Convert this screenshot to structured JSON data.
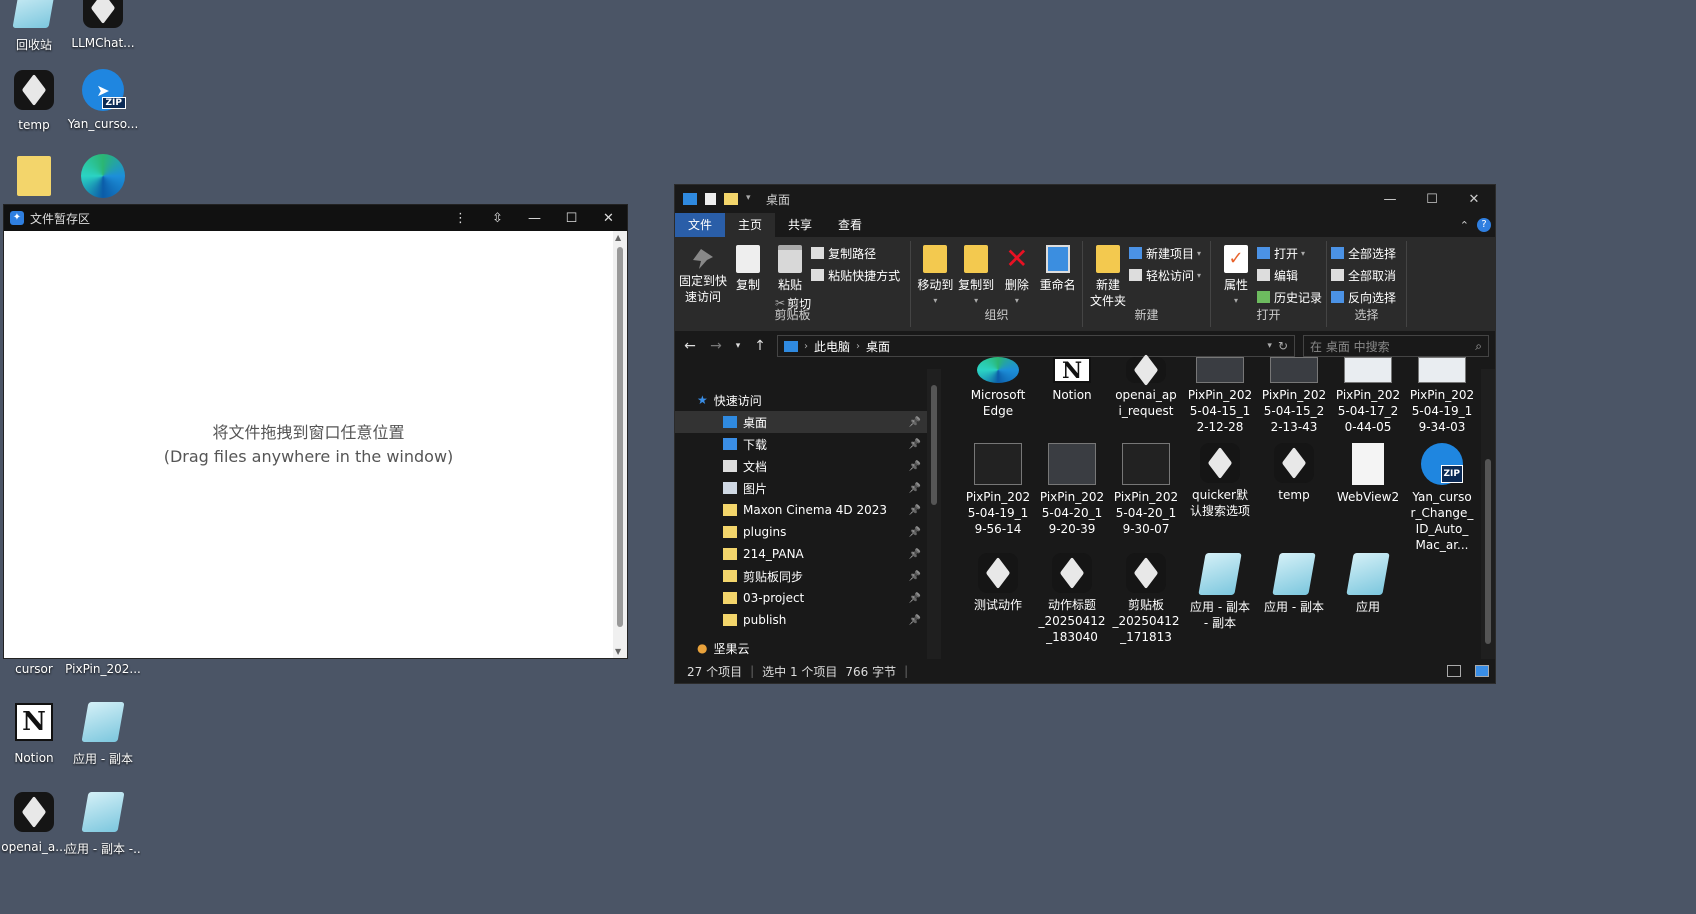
{
  "desktop": {
    "icons": [
      {
        "label": "回收站",
        "kind": "note"
      },
      {
        "label": "LLMChat...",
        "kind": "dark"
      },
      {
        "label": "temp",
        "kind": "dark"
      },
      {
        "label": "Yan_curso...",
        "kind": "zip"
      },
      {
        "label": "",
        "kind": "folder"
      },
      {
        "label": "",
        "kind": "edge"
      },
      {
        "label": "cursor",
        "kind": "dark"
      },
      {
        "label": "PixPin_202...",
        "kind": "shot"
      },
      {
        "label": "Notion",
        "kind": "notion"
      },
      {
        "label": "应用 - 副本",
        "kind": "note"
      },
      {
        "label": "openai_a...",
        "kind": "dark"
      },
      {
        "label": "应用 - 副本 -...",
        "kind": "note"
      }
    ]
  },
  "drop_window": {
    "title": "文件暂存区",
    "line1": "将文件拖拽到窗口任意位置",
    "line2": "(Drag files anywhere in the window)",
    "btn_more": "⋮",
    "btn_pin": "⇳",
    "btn_min": "—",
    "btn_max": "☐",
    "btn_close": "✕"
  },
  "explorer": {
    "title": "桌面",
    "btn_min": "—",
    "btn_max": "☐",
    "btn_close": "✕",
    "tabs": {
      "file": "文件",
      "home": "主页",
      "share": "共享",
      "view": "查看"
    },
    "ribbon": {
      "pin_quick": "固定到快\n速访问",
      "copy": "复制",
      "paste": "粘贴",
      "copy_path": "复制路径",
      "paste_shortcut": "粘贴快捷方式",
      "cut": "剪切",
      "group_clipboard": "剪贴板",
      "move_to": "移动到",
      "copy_to": "复制到",
      "delete": "删除",
      "rename": "重命名",
      "group_organize": "组织",
      "new_folder": "新建\n文件夹",
      "new_item": "新建项目",
      "easy_access": "轻松访问",
      "group_new": "新建",
      "properties": "属性",
      "open": "打开",
      "edit": "编辑",
      "history": "历史记录",
      "group_open": "打开",
      "select_all": "全部选择",
      "select_none": "全部取消",
      "invert_selection": "反向选择",
      "group_select": "选择"
    },
    "address": {
      "crumb_pc": "此电脑",
      "crumb_desktop": "桌面",
      "search_placeholder": "在 桌面 中搜索"
    },
    "nav": {
      "quick_access": "快速访问",
      "items": [
        {
          "label": "桌面",
          "icon": "desktop",
          "color": "#2f8ae0"
        },
        {
          "label": "下载",
          "icon": "download",
          "color": "#3a8ee6"
        },
        {
          "label": "文档",
          "icon": "document",
          "color": "#dddddd"
        },
        {
          "label": "图片",
          "icon": "picture",
          "color": "#cfd8e3"
        },
        {
          "label": "Maxon Cinema 4D 2023",
          "icon": "folder",
          "color": "#f3d56b"
        },
        {
          "label": "plugins",
          "icon": "folder",
          "color": "#f3d56b"
        },
        {
          "label": "214_PANA",
          "icon": "folder",
          "color": "#f3d56b"
        },
        {
          "label": "剪贴板同步",
          "icon": "folder",
          "color": "#f3d56b"
        },
        {
          "label": "03-project",
          "icon": "folder",
          "color": "#f3d56b"
        },
        {
          "label": "publish",
          "icon": "folder",
          "color": "#f3d56b"
        }
      ],
      "jianguoyun": "坚果云"
    },
    "files": [
      [
        {
          "label": "Microsoft\nEdge",
          "kind": "edge"
        },
        {
          "label": "Notion",
          "kind": "notion"
        },
        {
          "label": "openai_ap\ni_request",
          "kind": "dark"
        },
        {
          "label": "PixPin_202\n5-04-15_1\n2-12-28",
          "kind": "shot"
        },
        {
          "label": "PixPin_202\n5-04-15_2\n2-13-43",
          "kind": "shot"
        },
        {
          "label": "PixPin_202\n5-04-17_2\n0-44-05",
          "kind": "shot2"
        },
        {
          "label": "PixPin_202\n5-04-19_1\n9-34-03",
          "kind": "shot2"
        }
      ],
      [
        {
          "label": "PixPin_202\n5-04-19_1\n9-56-14",
          "kind": "shot3"
        },
        {
          "label": "PixPin_202\n5-04-20_1\n9-20-39",
          "kind": "shot"
        },
        {
          "label": "PixPin_202\n5-04-20_1\n9-30-07",
          "kind": "shot3"
        },
        {
          "label": "quicker默\n认搜索选项",
          "kind": "dark"
        },
        {
          "label": "temp",
          "kind": "dark"
        },
        {
          "label": "WebView2",
          "kind": "textdoc"
        },
        {
          "label": "Yan_curso\nr_Change_\nID_Auto_\nMac_ar...",
          "kind": "zip"
        }
      ],
      [
        {
          "label": "测试动作",
          "kind": "dark"
        },
        {
          "label": "动作标题\n_20250412\n_183040",
          "kind": "dark"
        },
        {
          "label": "剪贴板\n_20250412\n_171813",
          "kind": "dark"
        },
        {
          "label": "应用 - 副本\n- 副本",
          "kind": "note"
        },
        {
          "label": "应用 - 副本",
          "kind": "note"
        },
        {
          "label": "应用",
          "kind": "note"
        }
      ]
    ],
    "status": {
      "count": "27 个项目",
      "selected": "选中 1 个项目",
      "size": "766 字节"
    }
  }
}
